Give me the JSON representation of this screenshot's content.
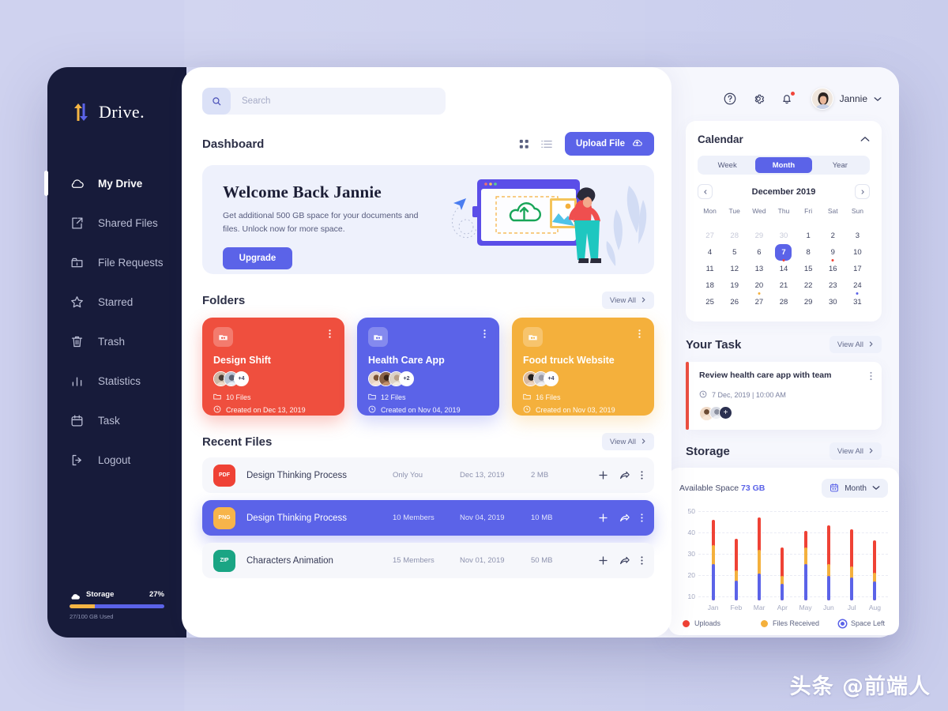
{
  "brand": {
    "name": "Drive.",
    "logo_icon": "up-down-arrows-icon"
  },
  "sidebar": {
    "items": [
      {
        "label": "My Drive",
        "icon": "cloud-icon",
        "active": true
      },
      {
        "label": "Shared Files",
        "icon": "share-box-icon",
        "active": false
      },
      {
        "label": "File Requests",
        "icon": "folder-lock-icon",
        "active": false
      },
      {
        "label": "Starred",
        "icon": "star-icon",
        "active": false
      },
      {
        "label": "Trash",
        "icon": "trash-icon",
        "active": false
      },
      {
        "label": "Statistics",
        "icon": "bar-chart-icon",
        "active": false
      },
      {
        "label": "Task",
        "icon": "calendar-icon",
        "active": false
      },
      {
        "label": "Logout",
        "icon": "logout-icon",
        "active": false
      }
    ],
    "storage": {
      "label": "Storage",
      "percent": "27%",
      "percent_value": 27,
      "used_text": "27/100 GB Used",
      "bar_used_color": "#f5b544",
      "bar_track_color": "#5b63e8"
    }
  },
  "search": {
    "placeholder": "Search",
    "icon": "search-icon"
  },
  "dashboard": {
    "title": "Dashboard",
    "grid_view_icon": "grid-view-icon",
    "list_view_icon": "list-view-icon",
    "upload_label": "Upload File",
    "upload_icon": "cloud-upload-icon"
  },
  "banner": {
    "title": "Welcome Back Jannie",
    "subtitle": "Get additional 500 GB space for your documents and files. Unlock now for more space.",
    "button": "Upgrade"
  },
  "folders": {
    "section_title": "Folders",
    "view_all": "View All",
    "items": [
      {
        "name": "Design Shift",
        "files": "10 Files",
        "created": "Created on Dec 13, 2019",
        "extra_members": "+4",
        "color": "#ef4f3e",
        "theme": "fc-red"
      },
      {
        "name": "Health Care App",
        "files": "12 Files",
        "created": "Created on Nov 04, 2019",
        "extra_members": "+2",
        "color": "#5b63e8",
        "theme": "fc-blue"
      },
      {
        "name": "Food truck Website",
        "files": "16 Files",
        "created": "Created on Nov 03, 2019",
        "extra_members": "+4",
        "color": "#f4b03c",
        "theme": "fc-yellow"
      }
    ]
  },
  "recent_files": {
    "section_title": "Recent Files",
    "view_all": "View All",
    "rows": [
      {
        "type": "PDF",
        "type_class": "ft-pdf",
        "name": "Design Thinking Process",
        "members": "Only You",
        "date": "Dec 13, 2019",
        "size": "2 MB",
        "selected": false
      },
      {
        "type": "PNG",
        "type_class": "ft-png",
        "name": "Design Thinking Process",
        "members": "10 Members",
        "date": "Nov 04, 2019",
        "size": "10 MB",
        "selected": true
      },
      {
        "type": "ZIP",
        "type_class": "ft-zip",
        "name": "Characters Animation",
        "members": "15 Members",
        "date": "Nov 01, 2019",
        "size": "50 MB",
        "selected": false
      }
    ],
    "row_actions": [
      "add-icon",
      "share-icon",
      "more-icon"
    ]
  },
  "topbar": {
    "help_icon": "help-circle-icon",
    "settings_icon": "gear-icon",
    "notifications_icon": "bell-icon",
    "has_notification": true,
    "user_name": "Jannie",
    "chevron_icon": "chevron-down-icon"
  },
  "calendar": {
    "title": "Calendar",
    "collapse_icon": "chevron-up-icon",
    "ranges": [
      "Week",
      "Month",
      "Year"
    ],
    "active_range": "Month",
    "month_label": "December 2019",
    "prev_icon": "chevron-left-icon",
    "next_icon": "chevron-right-icon",
    "dow": [
      "Mon",
      "Tue",
      "Wed",
      "Thu",
      "Fri",
      "Sat",
      "Sun"
    ],
    "days": [
      {
        "n": "27",
        "mute": true
      },
      {
        "n": "28",
        "mute": true
      },
      {
        "n": "29",
        "mute": true
      },
      {
        "n": "30",
        "mute": true
      },
      {
        "n": "1"
      },
      {
        "n": "2"
      },
      {
        "n": "3"
      },
      {
        "n": "4"
      },
      {
        "n": "5"
      },
      {
        "n": "6"
      },
      {
        "n": "7",
        "today": true,
        "dot": "#ef4235"
      },
      {
        "n": "8"
      },
      {
        "n": "9",
        "dot": "#ef4235"
      },
      {
        "n": "10"
      },
      {
        "n": "11"
      },
      {
        "n": "12"
      },
      {
        "n": "13"
      },
      {
        "n": "14"
      },
      {
        "n": "15"
      },
      {
        "n": "16"
      },
      {
        "n": "17"
      },
      {
        "n": "18"
      },
      {
        "n": "19"
      },
      {
        "n": "20",
        "dot": "#f4b03c"
      },
      {
        "n": "21"
      },
      {
        "n": "22"
      },
      {
        "n": "23"
      },
      {
        "n": "24",
        "dot": "#5b63e8"
      },
      {
        "n": "25"
      },
      {
        "n": "26"
      },
      {
        "n": "27"
      },
      {
        "n": "28"
      },
      {
        "n": "29"
      },
      {
        "n": "30"
      },
      {
        "n": "31"
      }
    ]
  },
  "task": {
    "section_title": "Your Task",
    "view_all": "View All",
    "name": "Review health care app with team",
    "time": "7 Dec, 2019  |  10:00 AM",
    "clock_icon": "clock-icon",
    "more_icon": "more-icon",
    "add_member": "+",
    "accent_color": "#ef4f3e"
  },
  "storage_section": {
    "section_title": "Storage",
    "view_all": "View All"
  },
  "chart_data": {
    "type": "bar",
    "title": "Available Space",
    "available_space": "73 GB",
    "period_label": "Month",
    "period_icon": "calendar-icon",
    "chevron_icon": "chevron-down-icon",
    "stacked": true,
    "categories": [
      "Jan",
      "Feb",
      "Mar",
      "Apr",
      "May",
      "Jun",
      "Jul",
      "Aug"
    ],
    "ylim": [
      8,
      52
    ],
    "yticks": [
      10,
      20,
      30,
      40,
      50
    ],
    "ylabel": "",
    "xlabel": "",
    "grid": true,
    "legend_position": "bottom",
    "series": [
      {
        "name": "Space Left",
        "color": "#5b63e8",
        "values": [
          25,
          17.5,
          20.5,
          16,
          25,
          19.5,
          19,
          17
        ]
      },
      {
        "name": "Files Received",
        "color": "#f4b03c",
        "values": [
          9,
          4.5,
          11.5,
          3.5,
          8,
          5.5,
          5,
          4
        ]
      },
      {
        "name": "Uploads",
        "color": "#ef4235",
        "values": [
          12,
          15,
          15,
          13.5,
          8,
          18.5,
          17.5,
          15.5
        ]
      }
    ],
    "cumulative_tops": {
      "Space Left": [
        25,
        17.5,
        20.5,
        16,
        25,
        19.5,
        19,
        17
      ],
      "Files Received": [
        34,
        22,
        32,
        19.5,
        33,
        25,
        24,
        21
      ],
      "Uploads": [
        46,
        37,
        47,
        33,
        41,
        43.5,
        41.5,
        36.5
      ]
    }
  },
  "watermark": "头条 @前端人"
}
